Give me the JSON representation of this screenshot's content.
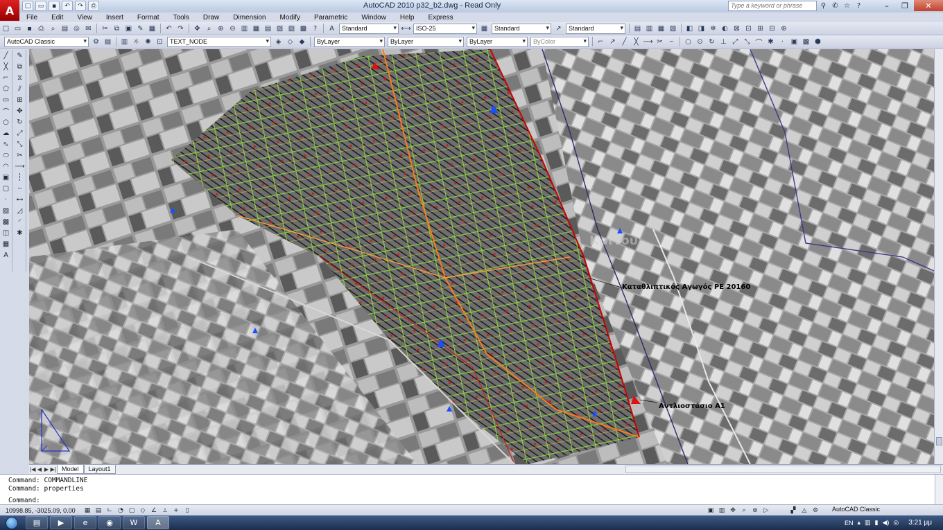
{
  "window": {
    "title": "AutoCAD 2010     p32_b2.dwg - Read Only",
    "search_placeholder": "Type a keyword or phrase"
  },
  "menu": [
    "File",
    "Edit",
    "View",
    "Insert",
    "Format",
    "Tools",
    "Draw",
    "Dimension",
    "Modify",
    "Parametric",
    "Window",
    "Help",
    "Express"
  ],
  "toolbar_styles": {
    "text_style": "Standard",
    "dim_style": "ISO-25",
    "table_style": "Standard",
    "multileader_style": "Standard"
  },
  "properties_toolbar": {
    "workspace": "AutoCAD Classic",
    "layer": "TEXT_NODE",
    "color": "ByLayer",
    "linetype": "ByLayer",
    "lineweight": "ByLayer",
    "plot_style": "ByColor"
  },
  "drawing": {
    "label_main": "Καταθλιπτικός Αγωγός PE 20160",
    "label_station": "Αντλιοστάσιο A1",
    "watermark": "Κριτου"
  },
  "layout_tabs": [
    "Model",
    "Layout1"
  ],
  "command_line": {
    "history": [
      "Command: COMMANDLINE",
      "Command: properties"
    ],
    "prompt": "Command:"
  },
  "status": {
    "coordinates": "10998.85, -3025.09, 0.00",
    "workspace": "AutoCAD Classic"
  },
  "taskbar": {
    "language": "EN",
    "clock": "3:21 μμ"
  },
  "colors": {
    "accent_red": "#cc0000",
    "contour_green": "#7ddc2f",
    "node_blue": "#1a4fff",
    "pipe_orange": "#ff7a1a"
  }
}
